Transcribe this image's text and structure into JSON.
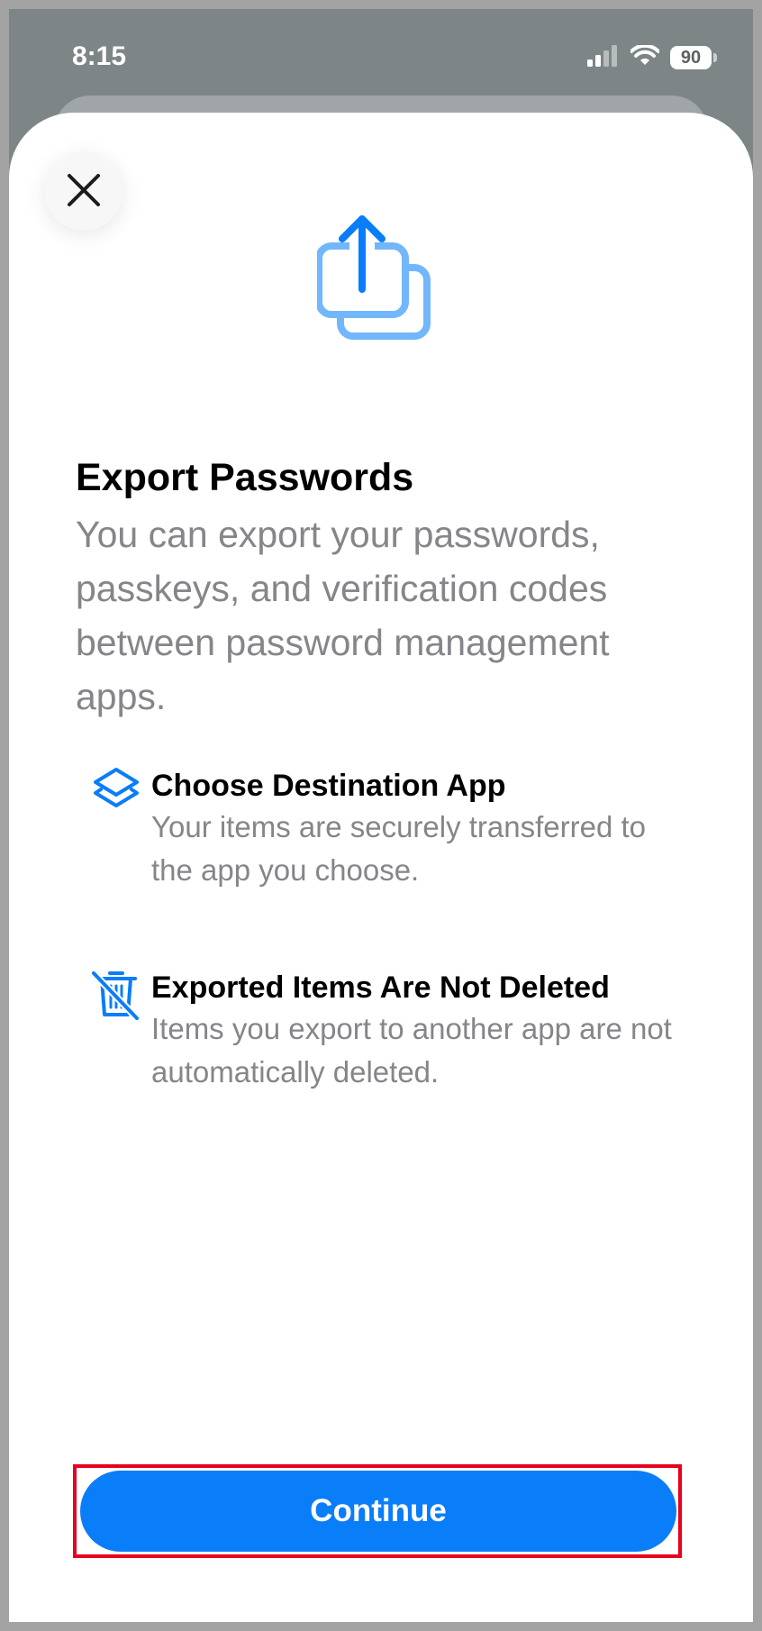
{
  "status_bar": {
    "time": "8:15",
    "battery_level": "90",
    "icons": [
      "cellular-signal-icon",
      "wifi-icon",
      "battery-icon"
    ]
  },
  "sheet": {
    "title": "Export Passwords",
    "subtitle": "You can export your passwords, passkeys, and verification codes between password management apps.",
    "hero_icon": "share-export-icon",
    "features": [
      {
        "icon": "layers-icon",
        "title": "Choose Destination App",
        "description": "Your items are securely transferred to the app you choose."
      },
      {
        "icon": "trash-slash-icon",
        "title": "Exported Items Are Not Deleted",
        "description": "Items you export to another app are not automatically deleted."
      }
    ],
    "primary_button_label": "Continue",
    "close_icon": "close-icon"
  },
  "colors": {
    "accent": "#0a7df8",
    "icon_light_blue": "#72b7fb",
    "highlight_border": "#e8001c",
    "secondary_text": "#85858a"
  }
}
